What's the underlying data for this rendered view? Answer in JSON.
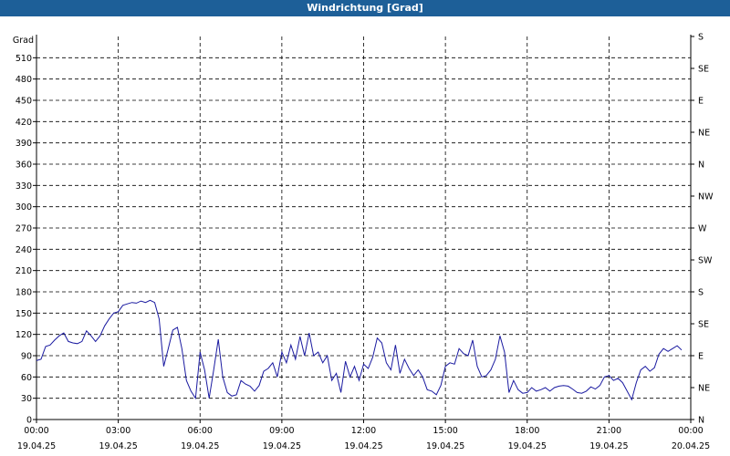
{
  "window": {
    "title": "Windrichtung [Grad]"
  },
  "chart_data": {
    "type": "line",
    "title": "Windrichtung [Grad]",
    "ylabel": "Grad",
    "ylim": [
      0,
      540
    ],
    "y_ticks": [
      0,
      30,
      60,
      90,
      120,
      150,
      180,
      210,
      240,
      270,
      300,
      330,
      360,
      390,
      420,
      450,
      480,
      510
    ],
    "y2_ticks": [
      {
        "value": 0,
        "label": "N"
      },
      {
        "value": 45,
        "label": "NE"
      },
      {
        "value": 90,
        "label": "E"
      },
      {
        "value": 135,
        "label": "SE"
      },
      {
        "value": 180,
        "label": "S"
      },
      {
        "value": 225,
        "label": "SW"
      },
      {
        "value": 270,
        "label": "W"
      },
      {
        "value": 315,
        "label": "NW"
      },
      {
        "value": 360,
        "label": "N"
      },
      {
        "value": 405,
        "label": "NE"
      },
      {
        "value": 450,
        "label": "E"
      },
      {
        "value": 495,
        "label": "SE"
      },
      {
        "value": 540,
        "label": "S"
      }
    ],
    "xlim": [
      "19.04.25 00:00",
      "20.04.25 00:00"
    ],
    "x_ticks": [
      {
        "time": "00:00",
        "date": "19.04.25"
      },
      {
        "time": "03:00",
        "date": "19.04.25"
      },
      {
        "time": "06:00",
        "date": "19.04.25"
      },
      {
        "time": "09:00",
        "date": "19.04.25"
      },
      {
        "time": "12:00",
        "date": "19.04.25"
      },
      {
        "time": "15:00",
        "date": "19.04.25"
      },
      {
        "time": "18:00",
        "date": "19.04.25"
      },
      {
        "time": "21:00",
        "date": "19.04.25"
      },
      {
        "time": "00:00",
        "date": "20.04.25"
      }
    ],
    "grid": true,
    "line_color": "#1a1aa0",
    "series": [
      {
        "points": [
          [
            "00:00",
            83
          ],
          [
            "00:10",
            85
          ],
          [
            "00:20",
            103
          ],
          [
            "00:30",
            105
          ],
          [
            "00:40",
            112
          ],
          [
            "00:50",
            118
          ],
          [
            "01:00",
            122
          ],
          [
            "01:10",
            110
          ],
          [
            "01:20",
            108
          ],
          [
            "01:30",
            107
          ],
          [
            "01:40",
            110
          ],
          [
            "01:50",
            125
          ],
          [
            "02:00",
            118
          ],
          [
            "02:10",
            110
          ],
          [
            "02:20",
            118
          ],
          [
            "02:30",
            132
          ],
          [
            "02:40",
            142
          ],
          [
            "02:50",
            150
          ],
          [
            "03:00",
            152
          ],
          [
            "03:10",
            161
          ],
          [
            "03:20",
            163
          ],
          [
            "03:30",
            165
          ],
          [
            "03:40",
            164
          ],
          [
            "03:50",
            167
          ],
          [
            "04:00",
            165
          ],
          [
            "04:10",
            168
          ],
          [
            "04:20",
            165
          ],
          [
            "04:30",
            142
          ],
          [
            "04:40",
            75
          ],
          [
            "04:50",
            100
          ],
          [
            "05:00",
            126
          ],
          [
            "05:10",
            130
          ],
          [
            "05:20",
            100
          ],
          [
            "05:30",
            55
          ],
          [
            "05:40",
            40
          ],
          [
            "05:50",
            30
          ],
          [
            "06:00",
            95
          ],
          [
            "06:10",
            70
          ],
          [
            "06:20",
            30
          ],
          [
            "06:30",
            70
          ],
          [
            "06:40",
            113
          ],
          [
            "06:50",
            60
          ],
          [
            "07:00",
            38
          ],
          [
            "07:10",
            33
          ],
          [
            "07:20",
            35
          ],
          [
            "07:30",
            55
          ],
          [
            "07:40",
            50
          ],
          [
            "07:50",
            47
          ],
          [
            "08:00",
            40
          ],
          [
            "08:10",
            48
          ],
          [
            "08:20",
            68
          ],
          [
            "08:30",
            72
          ],
          [
            "08:40",
            80
          ],
          [
            "08:50",
            60
          ],
          [
            "09:00",
            95
          ],
          [
            "09:10",
            80
          ],
          [
            "09:20",
            105
          ],
          [
            "09:30",
            85
          ],
          [
            "09:40",
            117
          ],
          [
            "09:50",
            90
          ],
          [
            "10:00",
            122
          ],
          [
            "10:10",
            90
          ],
          [
            "10:20",
            95
          ],
          [
            "10:30",
            80
          ],
          [
            "10:40",
            90
          ],
          [
            "10:50",
            55
          ],
          [
            "11:00",
            65
          ],
          [
            "11:10",
            38
          ],
          [
            "11:20",
            82
          ],
          [
            "11:30",
            60
          ],
          [
            "11:40",
            75
          ],
          [
            "11:50",
            55
          ],
          [
            "12:00",
            78
          ],
          [
            "12:10",
            72
          ],
          [
            "12:20",
            88
          ],
          [
            "12:30",
            115
          ],
          [
            "12:40",
            108
          ],
          [
            "12:50",
            80
          ],
          [
            "13:00",
            70
          ],
          [
            "13:10",
            105
          ],
          [
            "13:20",
            65
          ],
          [
            "13:30",
            85
          ],
          [
            "13:40",
            72
          ],
          [
            "13:50",
            62
          ],
          [
            "14:00",
            70
          ],
          [
            "14:10",
            60
          ],
          [
            "14:20",
            42
          ],
          [
            "14:30",
            40
          ],
          [
            "14:40",
            35
          ],
          [
            "14:50",
            48
          ],
          [
            "15:00",
            75
          ],
          [
            "15:10",
            80
          ],
          [
            "15:20",
            78
          ],
          [
            "15:30",
            100
          ],
          [
            "15:40",
            93
          ],
          [
            "15:50",
            90
          ],
          [
            "16:00",
            112
          ],
          [
            "16:10",
            75
          ],
          [
            "16:20",
            60
          ],
          [
            "16:30",
            62
          ],
          [
            "16:40",
            70
          ],
          [
            "16:50",
            85
          ],
          [
            "17:00",
            118
          ],
          [
            "17:10",
            95
          ],
          [
            "17:20",
            38
          ],
          [
            "17:30",
            55
          ],
          [
            "17:40",
            42
          ],
          [
            "17:50",
            37
          ],
          [
            "18:00",
            38
          ],
          [
            "18:10",
            45
          ],
          [
            "18:20",
            40
          ],
          [
            "18:30",
            42
          ],
          [
            "18:40",
            45
          ],
          [
            "18:50",
            40
          ],
          [
            "19:00",
            45
          ],
          [
            "19:10",
            47
          ],
          [
            "19:20",
            48
          ],
          [
            "19:30",
            47
          ],
          [
            "19:40",
            43
          ],
          [
            "19:50",
            38
          ],
          [
            "20:00",
            37
          ],
          [
            "20:10",
            40
          ],
          [
            "20:20",
            46
          ],
          [
            "20:30",
            43
          ],
          [
            "20:40",
            48
          ],
          [
            "20:50",
            60
          ],
          [
            "21:00",
            62
          ],
          [
            "21:10",
            55
          ],
          [
            "21:20",
            58
          ],
          [
            "21:30",
            52
          ],
          [
            "21:40",
            40
          ],
          [
            "21:50",
            28
          ],
          [
            "22:00",
            52
          ],
          [
            "22:10",
            70
          ],
          [
            "22:20",
            75
          ],
          [
            "22:30",
            68
          ],
          [
            "22:40",
            73
          ],
          [
            "22:50",
            92
          ],
          [
            "23:00",
            100
          ],
          [
            "23:10",
            96
          ],
          [
            "23:20",
            100
          ],
          [
            "23:30",
            104
          ],
          [
            "23:40",
            98
          ]
        ]
      }
    ]
  }
}
